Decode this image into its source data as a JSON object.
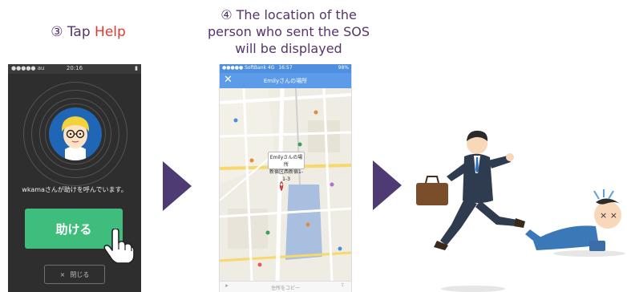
{
  "step3": {
    "prefix": "③ Tap ",
    "highlight": "Help"
  },
  "step4": {
    "line1": "④ The location of the",
    "line2": "person who sent the SOS",
    "line3": "will be displayed"
  },
  "phone1": {
    "status": {
      "carrier": "●●●●● au  ",
      "time": "20:16",
      "battery": "▮"
    },
    "help_message": "wkamaさんが助けを呼んでいます。",
    "help_button": "助ける",
    "close_button": {
      "icon": "×",
      "label": "閉じる"
    }
  },
  "phone2": {
    "status": {
      "carrier": "●●●●● SoftBank  4G",
      "time": "16:57",
      "battery": "98%"
    },
    "nav_title": "Emilyさんの場所",
    "close_icon": "✕",
    "callout": {
      "title": "Emilyさんの場所",
      "subtitle": "新宿区西新宿1-1-3"
    },
    "bottom_bar": {
      "left_icon": "➤",
      "center": "住所をコピー",
      "right_icon": "⇪"
    }
  },
  "colors": {
    "accent_purple": "#55356b",
    "highlight_red": "#e03a2e",
    "help_green": "#3fbd7c",
    "arrow": "#4e3b73",
    "nav_blue": "#5b9bea"
  }
}
